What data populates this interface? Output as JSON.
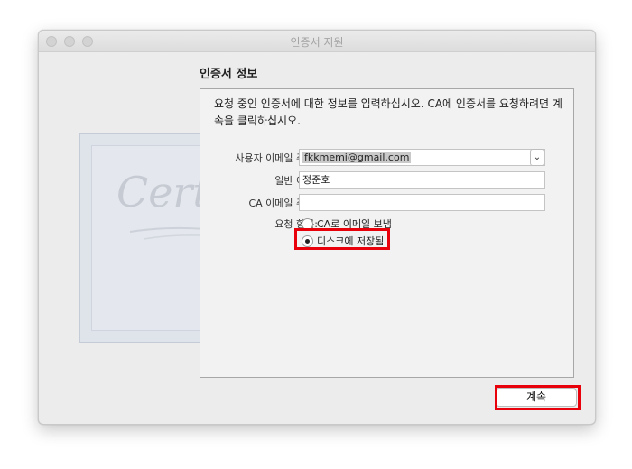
{
  "window": {
    "title": "인증서 지원"
  },
  "section": {
    "title": "인증서 정보"
  },
  "intro": {
    "text": "요청 중인 인증서에 대한 정보를 입력하십시오. CA에 인증서를 요청하려면 계속을 클릭하십시오."
  },
  "form": {
    "email_label": "사용자 이메일 주소:",
    "email_value": "fkkmemi@gmail.com",
    "name_label": "일반 이름:",
    "name_value": "정준호",
    "ca_label": "CA 이메일 주소:",
    "ca_value": "",
    "request_label": "요청 항목:",
    "options": [
      {
        "label": "CA로 이메일 보냄",
        "selected": false
      },
      {
        "label": "디스크에 저장됨",
        "selected": true
      }
    ]
  },
  "buttons": {
    "continue": "계속"
  },
  "certificate": {
    "text": "Certificate"
  },
  "colors": {
    "highlight": "#e8000b"
  }
}
